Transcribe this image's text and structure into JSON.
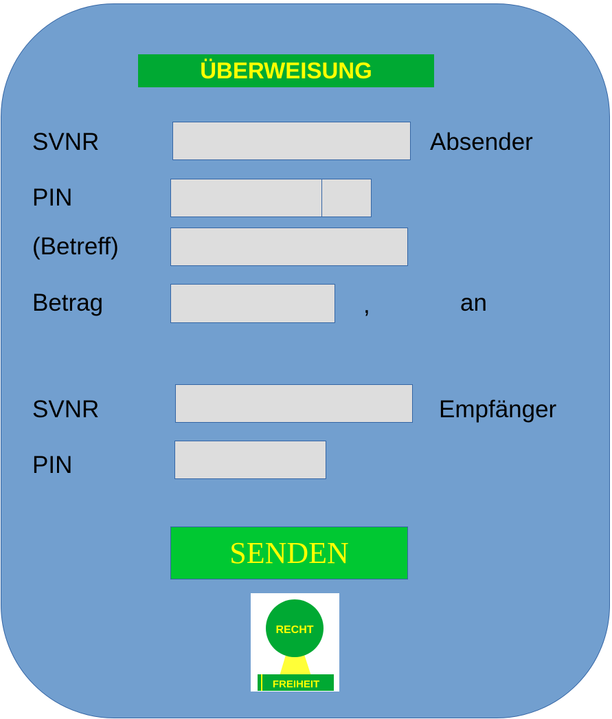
{
  "title": "ÜBERWEISUNG",
  "sender": {
    "svnr_label": "SVNR",
    "role_label": "Absender",
    "pin_label": "PIN",
    "subject_label": "(Betreff)",
    "amount_label": "Betrag",
    "decimal_separator": ",",
    "to_label": "an"
  },
  "recipient": {
    "svnr_label": "SVNR",
    "role_label": "Empfänger",
    "pin_label": "PIN"
  },
  "send_button_label": "SENDEN",
  "logo": {
    "top_text": "RECHT",
    "bottom_text": "FREIHEIT"
  },
  "colors": {
    "panel": "#729fcf",
    "panel_border": "#3465a4",
    "title_bg": "#00a933",
    "title_text": "#ffff00",
    "field_bg": "#dddddd",
    "button_bg": "#00c832",
    "button_text": "#ffff00"
  }
}
